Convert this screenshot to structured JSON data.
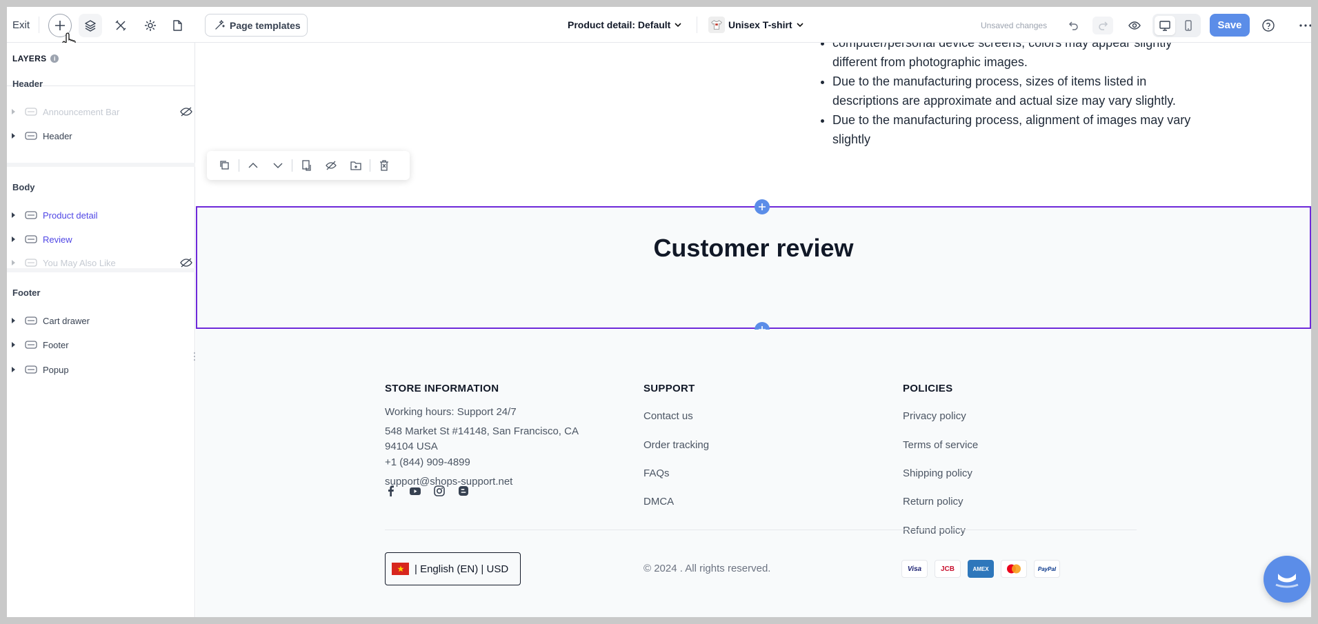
{
  "topbar": {
    "exit_label": "Exit",
    "templates_label": "Page templates",
    "page_dropdown": "Product detail: Default",
    "product_dropdown": "Unisex T-shirt",
    "unsaved_text": "Unsaved changes",
    "save_label": "Save"
  },
  "sidebar": {
    "title": "LAYERS",
    "info_glyph": "i",
    "sections": [
      {
        "title": "Header",
        "items": [
          {
            "label": "Announcement Bar",
            "state": "hidden"
          },
          {
            "label": "Header",
            "state": "normal"
          }
        ]
      },
      {
        "title": "Body",
        "items": [
          {
            "label": "Product detail",
            "state": "active"
          },
          {
            "label": "Review",
            "state": "active"
          },
          {
            "label": "You May Also Like",
            "state": "hidden"
          }
        ]
      },
      {
        "title": "Footer",
        "items": [
          {
            "label": "Cart drawer",
            "state": "normal"
          },
          {
            "label": "Footer",
            "state": "normal"
          },
          {
            "label": "Popup",
            "state": "normal"
          }
        ]
      }
    ]
  },
  "canvas": {
    "description_bullets": [
      "computer/personal device screens, colors may appear slightly different from photographic images.",
      "Due to the manufacturing process, sizes of items listed in descriptions are approximate and actual size may vary slightly.",
      "Due to the manufacturing process, alignment of images may vary slightly"
    ],
    "review_title": "Customer review",
    "selection_color": "#6d28d9",
    "accent_color": "#5b8de8"
  },
  "footer": {
    "store": {
      "title": "STORE INFORMATION",
      "hours": "Working hours: Support 24/7",
      "address": "548 Market St #14148, San Francisco, CA 94104 USA",
      "phone": "+1 (844) 909-4899",
      "email": "support@shops-support.net"
    },
    "support": {
      "title": "SUPPORT",
      "links": [
        "Contact us",
        "Order tracking",
        "FAQs",
        "DMCA"
      ]
    },
    "policies": {
      "title": "POLICIES",
      "links": [
        "Privacy policy",
        "Terms of service",
        "Shipping policy",
        "Return policy",
        "Refund policy"
      ]
    },
    "language": "| English (EN) | USD",
    "copyright": "© 2024 . All rights reserved.",
    "payments": [
      "VISA",
      "JCB",
      "AMEX",
      "Mastercard",
      "PayPal"
    ],
    "payment_labels": {
      "visa": "Visa",
      "jcb": "JCB",
      "amex": "AMEX",
      "paypal": "PayPal"
    },
    "social_icons": [
      "facebook-icon",
      "youtube-icon",
      "instagram-icon",
      "blogger-icon"
    ]
  }
}
